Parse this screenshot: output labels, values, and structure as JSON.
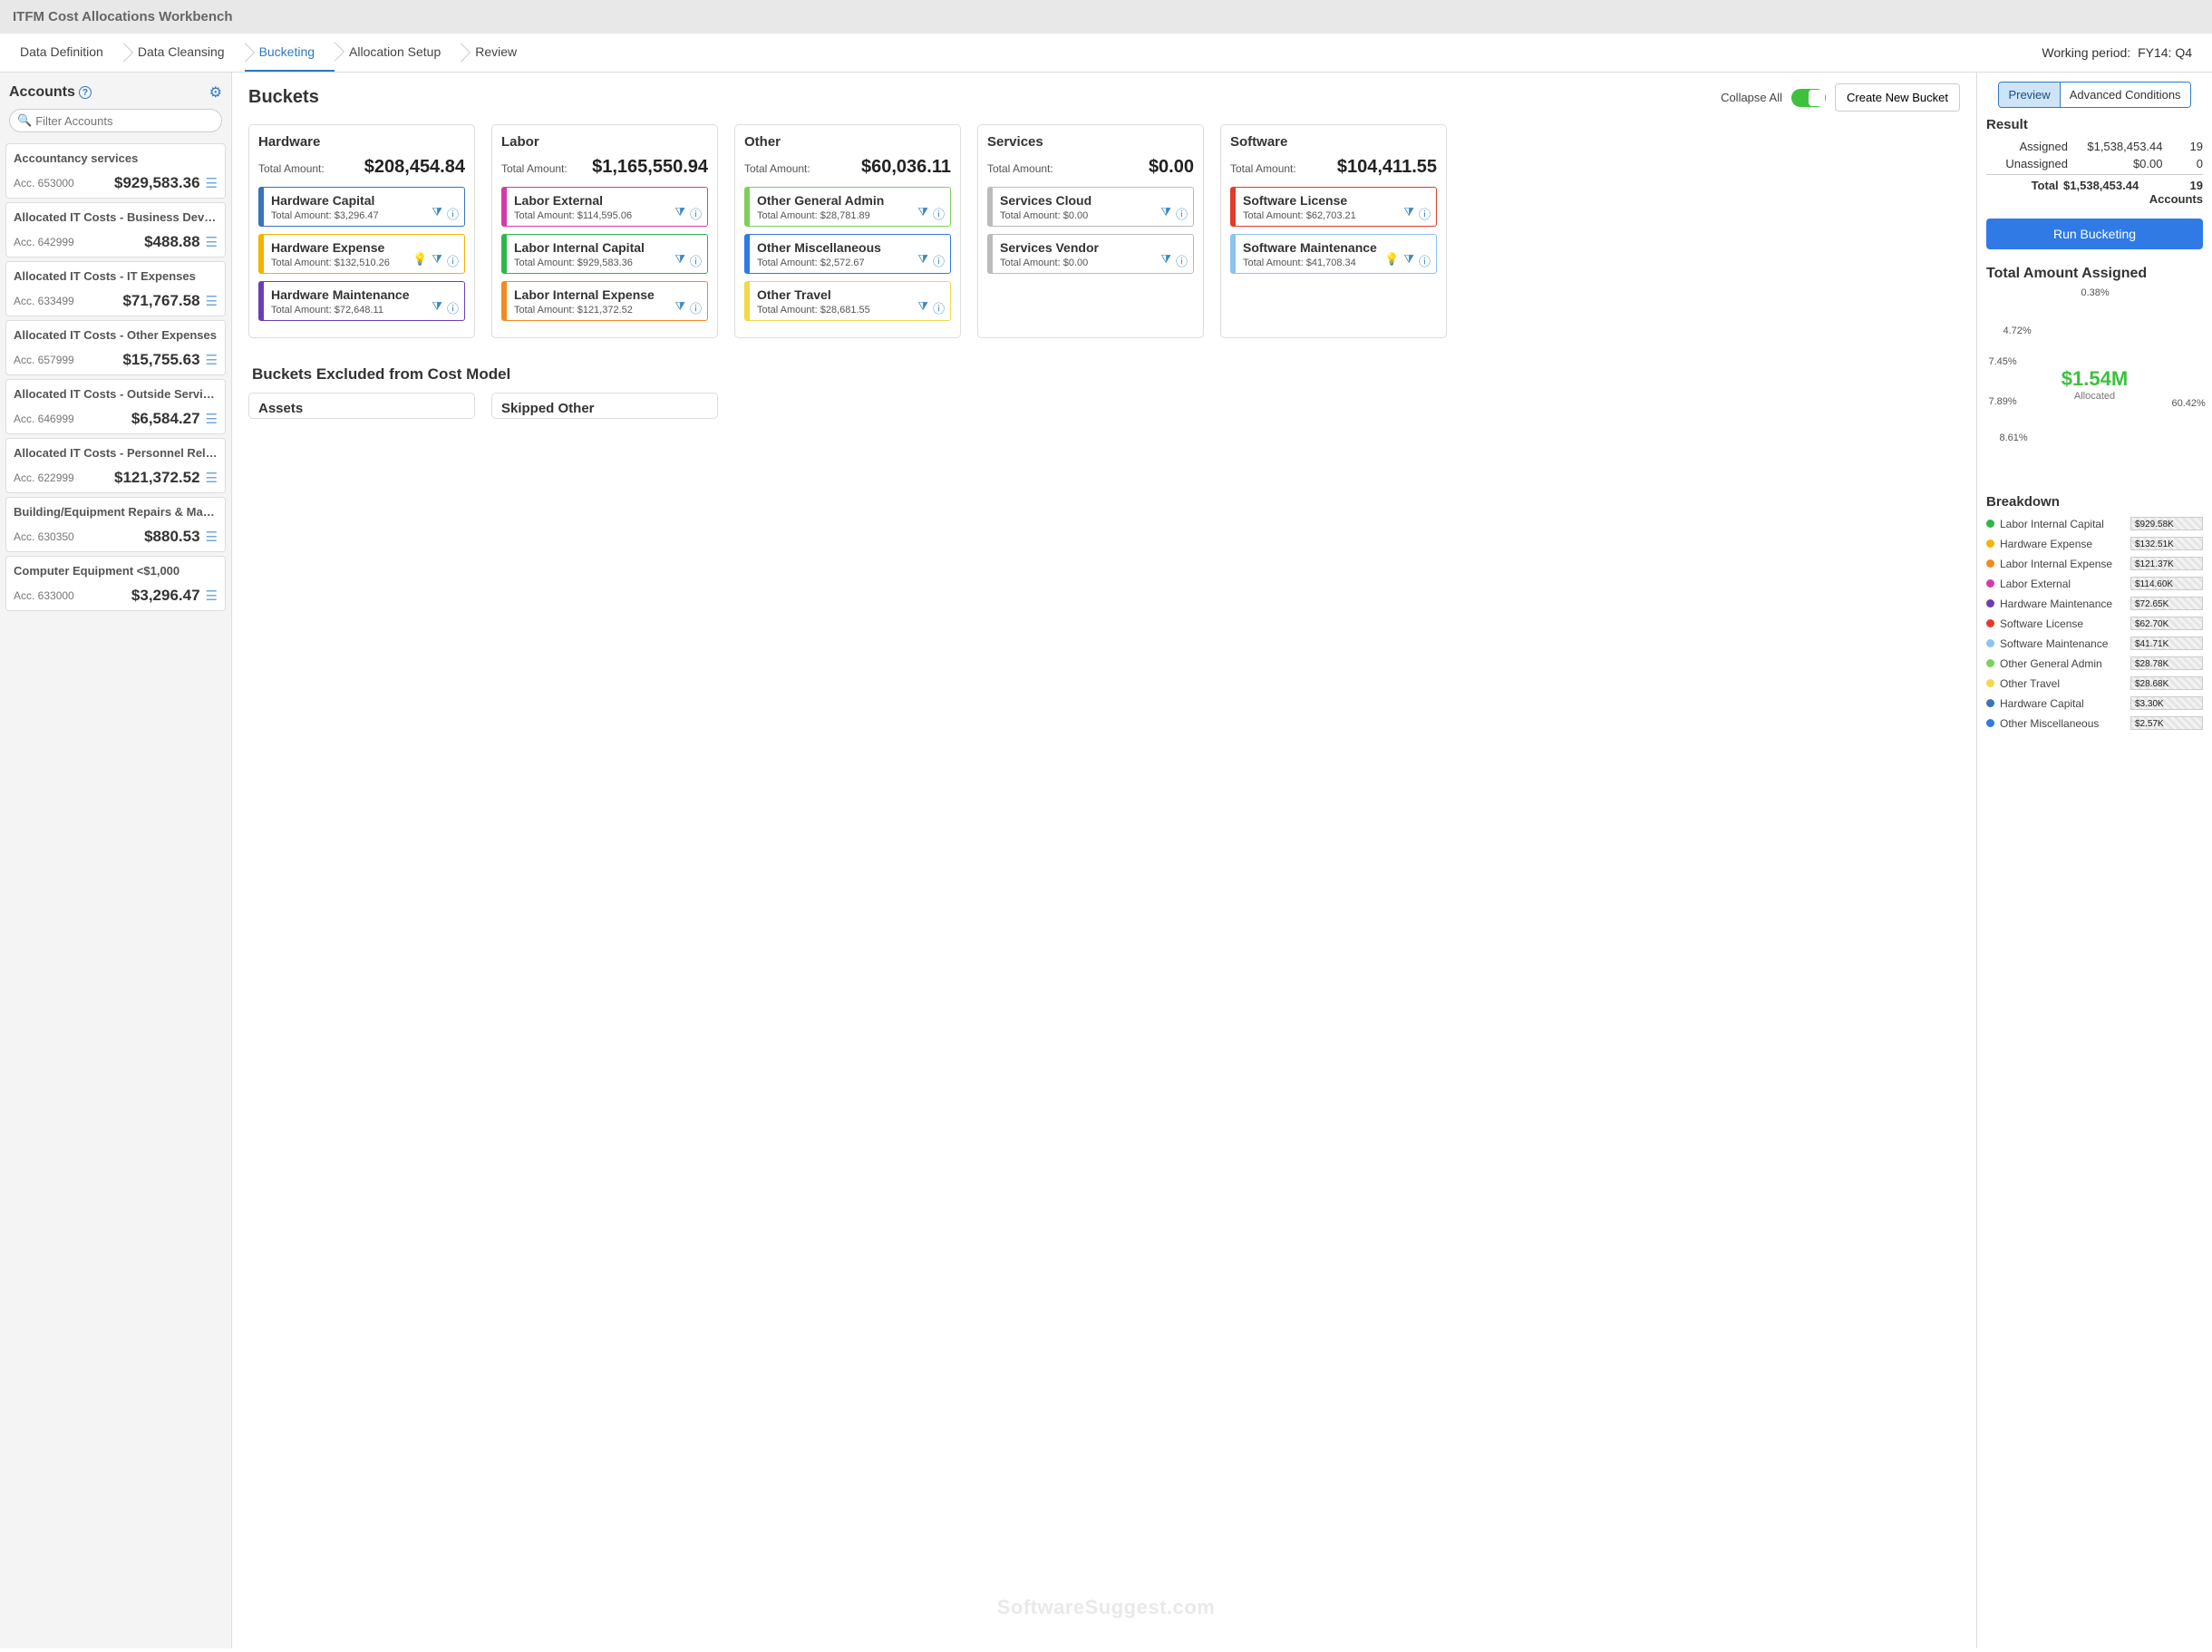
{
  "app_title": "ITFM Cost Allocations Workbench",
  "working_period_label": "Working period:",
  "working_period_value": "FY14: Q4",
  "wizard_steps": [
    "Data Definition",
    "Data Cleansing",
    "Bucketing",
    "Allocation Setup",
    "Review"
  ],
  "wizard_active_index": 2,
  "accounts": {
    "title": "Accounts",
    "filter_placeholder": "Filter Accounts",
    "items": [
      {
        "name": "Accountancy services",
        "code": "Acc. 653000",
        "amount": "$929,583.36"
      },
      {
        "name": "Allocated IT Costs - Business Devel...",
        "code": "Acc. 642999",
        "amount": "$488.88"
      },
      {
        "name": "Allocated IT Costs - IT Expenses",
        "code": "Acc. 633499",
        "amount": "$71,767.58"
      },
      {
        "name": "Allocated IT Costs - Other Expenses",
        "code": "Acc. 657999",
        "amount": "$15,755.63"
      },
      {
        "name": "Allocated IT Costs - Outside Service...",
        "code": "Acc. 646999",
        "amount": "$6,584.27"
      },
      {
        "name": "Allocated IT Costs - Personnel Relat...",
        "code": "Acc. 622999",
        "amount": "$121,372.52"
      },
      {
        "name": "Building/Equipment Repairs & Maint...",
        "code": "Acc. 630350",
        "amount": "$880.53"
      },
      {
        "name": "Computer Equipment <$1,000",
        "code": "Acc. 633000",
        "amount": "$3,296.47"
      }
    ]
  },
  "buckets": {
    "title": "Buckets",
    "collapse_label": "Collapse All",
    "create_label": "Create New Bucket",
    "groups": [
      {
        "name": "Hardware",
        "total": "$208,454.84",
        "subs": [
          {
            "name": "Hardware Capital",
            "amount": "$3,296.47",
            "color": "#3b73b9",
            "icons": [
              "funnel",
              "info"
            ]
          },
          {
            "name": "Hardware Expense",
            "amount": "$132,510.26",
            "color": "#f2b400",
            "icons": [
              "bulb",
              "funnel",
              "info"
            ]
          },
          {
            "name": "Hardware Maintenance",
            "amount": "$72,648.11",
            "color": "#6a3fb5",
            "icons": [
              "funnel",
              "info"
            ]
          }
        ]
      },
      {
        "name": "Labor",
        "total": "$1,165,550.94",
        "subs": [
          {
            "name": "Labor External",
            "amount": "$114,595.06",
            "color": "#d63aa6",
            "icons": [
              "funnel",
              "info"
            ]
          },
          {
            "name": "Labor Internal Capital",
            "amount": "$929,583.36",
            "color": "#2fb64a",
            "icons": [
              "funnel",
              "info"
            ]
          },
          {
            "name": "Labor Internal Expense",
            "amount": "$121,372.52",
            "color": "#f28b1e",
            "icons": [
              "funnel",
              "info"
            ]
          }
        ]
      },
      {
        "name": "Other",
        "total": "$60,036.11",
        "subs": [
          {
            "name": "Other General Admin",
            "amount": "$28,781.89",
            "color": "#7fcf5f",
            "icons": [
              "funnel",
              "info"
            ]
          },
          {
            "name": "Other Miscellaneous",
            "amount": "$2,572.67",
            "color": "#2f7ae5",
            "icons": [
              "funnel",
              "info"
            ]
          },
          {
            "name": "Other Travel",
            "amount": "$28,681.55",
            "color": "#f2d84a",
            "icons": [
              "funnel",
              "info"
            ]
          }
        ]
      },
      {
        "name": "Services",
        "total": "$0.00",
        "subs": [
          {
            "name": "Services Cloud",
            "amount": "$0.00",
            "color": "#bbbbbb",
            "icons": [
              "funnel",
              "info"
            ]
          },
          {
            "name": "Services Vendor",
            "amount": "$0.00",
            "color": "#bbbbbb",
            "icons": [
              "funnel",
              "info"
            ]
          }
        ]
      },
      {
        "name": "Software",
        "total": "$104,411.55",
        "subs": [
          {
            "name": "Software License",
            "amount": "$62,703.21",
            "color": "#e23b2e",
            "icons": [
              "funnel",
              "info"
            ]
          },
          {
            "name": "Software Maintenance",
            "amount": "$41,708.34",
            "color": "#8dc3ee",
            "icons": [
              "bulb",
              "funnel",
              "info"
            ]
          }
        ]
      }
    ],
    "excluded_title": "Buckets Excluded from Cost Model",
    "excluded": [
      "Assets",
      "Skipped Other"
    ]
  },
  "right": {
    "tabs": {
      "preview": "Preview",
      "advanced": "Advanced Conditions"
    },
    "result_title": "Result",
    "rows": [
      {
        "label": "Assigned",
        "v1": "$1,538,453.44",
        "v2": "19"
      },
      {
        "label": "Unassigned",
        "v1": "$0.00",
        "v2": "0"
      }
    ],
    "total": {
      "label": "Total",
      "v1": "$1,538,453.44",
      "v2": "19 Accounts"
    },
    "run_btn": "Run Bucketing",
    "chart_title": "Total Amount Assigned",
    "donut_center_big": "$1.54M",
    "donut_center_small": "Allocated",
    "breakdown_title": "Breakdown",
    "breakdown": [
      {
        "name": "Labor Internal Capital",
        "value": "$929.58K",
        "pct": 100,
        "color": "#2fb64a"
      },
      {
        "name": "Hardware Expense",
        "value": "$132.51K",
        "pct": 14.3,
        "color": "#f2b400"
      },
      {
        "name": "Labor Internal Expense",
        "value": "$121.37K",
        "pct": 13.1,
        "color": "#f28b1e"
      },
      {
        "name": "Labor External",
        "value": "$114.60K",
        "pct": 12.3,
        "color": "#d63aa6"
      },
      {
        "name": "Hardware Maintenance",
        "value": "$72.65K",
        "pct": 7.8,
        "color": "#6a3fb5"
      },
      {
        "name": "Software License",
        "value": "$62.70K",
        "pct": 6.7,
        "color": "#e23b2e"
      },
      {
        "name": "Software Maintenance",
        "value": "$41.71K",
        "pct": 4.5,
        "color": "#8dc3ee"
      },
      {
        "name": "Other General Admin",
        "value": "$28.78K",
        "pct": 3.1,
        "color": "#7fcf5f"
      },
      {
        "name": "Other Travel",
        "value": "$28.68K",
        "pct": 3.1,
        "color": "#f2d84a"
      },
      {
        "name": "Hardware Capital",
        "value": "$3.30K",
        "pct": 1.5,
        "color": "#3b73b9"
      },
      {
        "name": "Other Miscellaneous",
        "value": "$2.57K",
        "pct": 1.5,
        "color": "#2f7ae5"
      }
    ]
  },
  "chart_data": {
    "type": "pie",
    "title": "Total Amount Assigned",
    "center_label": "$1.54M Allocated",
    "series": [
      {
        "name": "Labor Internal Capital",
        "value": 929583.36,
        "pct": 60.42,
        "color": "#2fb64a"
      },
      {
        "name": "Hardware Expense",
        "value": 132510.26,
        "pct": 8.61,
        "color": "#f2b400"
      },
      {
        "name": "Labor Internal Expense",
        "value": 121372.52,
        "pct": 7.89,
        "color": "#f28b1e"
      },
      {
        "name": "Labor External",
        "value": 114595.06,
        "pct": 7.45,
        "color": "#d63aa6"
      },
      {
        "name": "Hardware Maintenance",
        "value": 72648.11,
        "pct": 4.72,
        "color": "#6a3fb5"
      },
      {
        "name": "Software License",
        "value": 62703.21,
        "pct": 4.08,
        "color": "#e23b2e"
      },
      {
        "name": "Software Maintenance",
        "value": 41708.34,
        "pct": 2.71,
        "color": "#8dc3ee"
      },
      {
        "name": "Other General Admin",
        "value": 28781.89,
        "pct": 1.87,
        "color": "#7fcf5f"
      },
      {
        "name": "Other Travel",
        "value": 28681.55,
        "pct": 1.86,
        "color": "#f2d84a"
      },
      {
        "name": "Hardware Capital",
        "value": 3296.47,
        "pct": 0.21,
        "color": "#3b73b9"
      },
      {
        "name": "Other Miscellaneous",
        "value": 2572.67,
        "pct": 0.17,
        "color": "#2f7ae5"
      }
    ],
    "labels_shown": [
      "60.42%",
      "8.61%",
      "7.89%",
      "7.45%",
      "4.72%",
      "0.38%"
    ]
  },
  "total_amount_label": "Total Amount:",
  "watermark": "SoftwareSuggest.com"
}
